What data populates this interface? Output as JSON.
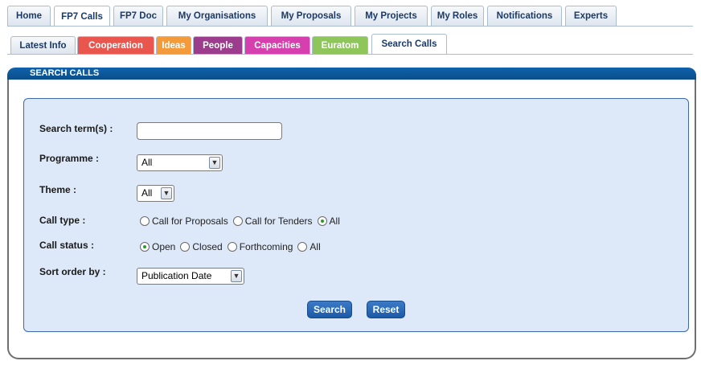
{
  "top_tabs": [
    {
      "label": "Home",
      "active": false
    },
    {
      "label": "FP7 Calls",
      "active": true
    },
    {
      "label": "FP7 Doc",
      "active": false
    },
    {
      "label": "My Organisations",
      "active": false
    },
    {
      "label": "My Proposals",
      "active": false
    },
    {
      "label": "My Projects",
      "active": false
    },
    {
      "label": "My Roles",
      "active": false
    },
    {
      "label": "Notifications",
      "active": false
    },
    {
      "label": "Experts",
      "active": false
    }
  ],
  "sub_tabs": [
    {
      "label": "Latest Info",
      "color": "#dde5ee"
    },
    {
      "label": "Cooperation",
      "color": "#e8564e"
    },
    {
      "label": "Ideas",
      "color": "#f39b3a"
    },
    {
      "label": "People",
      "color": "#9b3c8c"
    },
    {
      "label": "Capacities",
      "color": "#d63fae"
    },
    {
      "label": "Euratom",
      "color": "#8fc65c"
    },
    {
      "label": "Search Calls",
      "color": "#ffffff"
    }
  ],
  "panel": {
    "title": "SEARCH CALLS"
  },
  "form": {
    "search_terms_label": "Search term(s) :",
    "search_terms_value": "",
    "programme_label": "Programme :",
    "programme_value": "All",
    "theme_label": "Theme :",
    "theme_value": "All",
    "call_type_label": "Call type :",
    "call_type_options": [
      {
        "label": "Call for Proposals",
        "checked": false
      },
      {
        "label": "Call for Tenders",
        "checked": false
      },
      {
        "label": "All",
        "checked": true
      }
    ],
    "call_status_label": "Call status :",
    "call_status_options": [
      {
        "label": "Open",
        "checked": true
      },
      {
        "label": "Closed",
        "checked": false
      },
      {
        "label": "Forthcoming",
        "checked": false
      },
      {
        "label": "All",
        "checked": false
      }
    ],
    "sort_label": "Sort order by :",
    "sort_value": "Publication Date",
    "search_button": "Search",
    "reset_button": "Reset"
  },
  "colors": {
    "header_blue": "#0f63ab",
    "form_bg": "#dde9f8",
    "button_blue": "#2a6db9"
  }
}
